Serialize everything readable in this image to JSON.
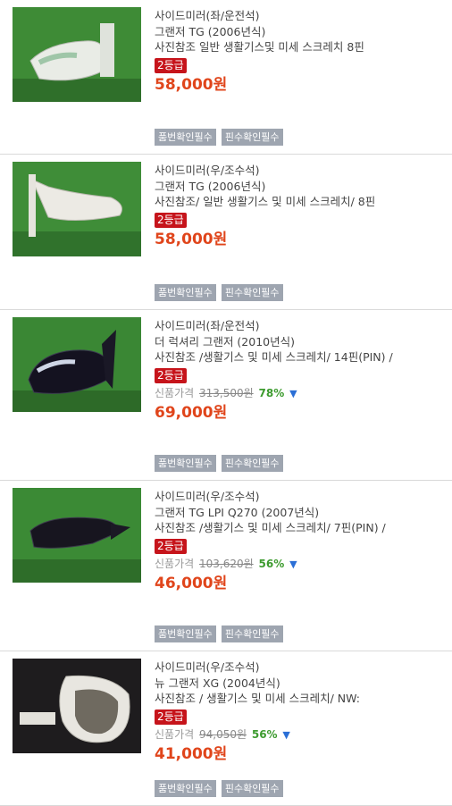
{
  "items": [
    {
      "lines": [
        "사이드미러(좌/운전석)",
        "그랜저 TG  (2006년식)",
        "사진참조 일반 생활기스및 미세 스크레치 8핀"
      ],
      "grade": "2등급",
      "price": "58,000원",
      "tags": [
        "품번확인필수",
        "핀수확인필수"
      ]
    },
    {
      "lines": [
        "사이드미러(우/조수석)",
        "그랜저 TG  (2006년식)",
        "사진참조/ 일반 생활기스 및 미세 스크레치/ 8핀"
      ],
      "grade": "2등급",
      "price": "58,000원",
      "tags": [
        "품번확인필수",
        "핀수확인필수"
      ]
    },
    {
      "lines": [
        "사이드미러(좌/운전석)",
        "더 럭셔리 그랜저  (2010년식)",
        "사진참조 /생활기스 및 미세 스크레치/ 14핀(PIN) /"
      ],
      "grade": "2등급",
      "orig_label": "신품가격",
      "orig_price": "313,500원",
      "discount": "78%",
      "price": "69,000원",
      "tags": [
        "품번확인필수",
        "핀수확인필수"
      ]
    },
    {
      "lines": [
        "사이드미러(우/조수석)",
        "그랜저 TG LPI Q270  (2007년식)",
        "사진참조 /생활기스 및 미세 스크레치/ 7핀(PIN) /"
      ],
      "grade": "2등급",
      "orig_label": "신품가격",
      "orig_price": "103,620원",
      "discount": "56%",
      "price": "46,000원",
      "tags": [
        "품번확인필수",
        "핀수확인필수"
      ]
    },
    {
      "lines": [
        "사이드미러(우/조수석)",
        "뉴 그랜저 XG  (2004년식)",
        "사진참조 / 생활기스 및 미세 스크레치/ NW:"
      ],
      "grade": "2등급",
      "orig_label": "신품가격",
      "orig_price": "94,050원",
      "discount": "56%",
      "price": "41,000원",
      "tags": [
        "품번확인필수",
        "핀수확인필수"
      ]
    }
  ],
  "icons": {
    "discount_arrow": "arrow-down-icon"
  },
  "colors": {
    "price": "#e0451b",
    "grade_bg": "#c6141b",
    "tag_bg": "#9ea5b0",
    "discount": "#3d9b2f"
  }
}
